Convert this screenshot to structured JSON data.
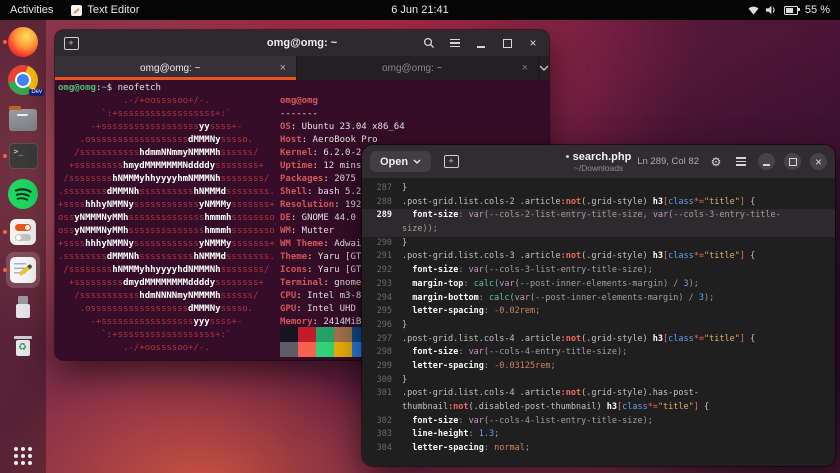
{
  "topbar": {
    "activities": "Activities",
    "app_name": "Text Editor",
    "clock": "6 Jun 21:41",
    "battery": "55 %"
  },
  "accent_color": "#e95420",
  "dock": {
    "chrome_badge": "Dev",
    "items": [
      {
        "name": "firefox",
        "running": true
      },
      {
        "name": "chrome-dev",
        "running": false
      },
      {
        "name": "files",
        "running": false
      },
      {
        "name": "terminal",
        "running": true
      },
      {
        "name": "spotify",
        "running": false
      },
      {
        "name": "toggles-settings",
        "running": true
      },
      {
        "name": "text-editor",
        "running": true,
        "active": true
      },
      {
        "name": "usb-drive",
        "running": false
      },
      {
        "name": "trash",
        "running": false
      }
    ]
  },
  "terminal": {
    "title": "omg@omg: ~",
    "tabs": [
      {
        "label": "omg@omg: ~",
        "active": true
      },
      {
        "label": "omg@omg: ~",
        "active": false
      }
    ],
    "prompt": {
      "user": "omg@omg",
      "colon": ":",
      "path": "~",
      "cmd": "$ neofetch"
    },
    "ascii_art": [
      "            .-/+oossssoo+/-.",
      "        `:+ssssssssssssssssss+:`",
      "      -+ssssssssssssssssssyyssss+-",
      "    .ossssssssssssssssssdMMMNysssso.",
      "   /ssssssssssshdmmNNmmyNMMMMhssssss/",
      "  +ssssssssshmydMMMMMMMNddddyssssssss+",
      " /sssssssshNMMMyhhyyyyhmNMMMNhssssssss/",
      ".ssssssssdMMMNhsssssssssshNMMMdssssssss.",
      "+sssshhhyNMMNyssssssssssssyNMMMysssssss+",
      "ossyNMMMNyMMhsssssssssssssshmmmhssssssso",
      "ossyNMMMNyMMhsssssssssssssshmmmhssssssso",
      "+sssshhhyNMMNyssssssssssssyNMMMysssssss+",
      ".ssssssssdMMMNhsssssssssshNMMMdssssssss.",
      " /sssssssshNMMMyhhyyyyhdNMMMNhssssssss/",
      "  +sssssssssdmydMMMMMMMMddddyssssssss+",
      "   /ssssssssssshdmNNNNmyNMMMMhssssss/",
      "    .ossssssssssssssssssdMMMNysssso.",
      "      -+sssssssssssssssssyyyssss+-",
      "        `:+ssssssssssssssssss+:`",
      "            .-/+oossssoo+/-."
    ],
    "info": {
      "title": "omg@omg",
      "underline": "-------",
      "rows": [
        [
          "OS",
          "Ubuntu 23.04 x86_64"
        ],
        [
          "Host",
          "AeroBook Pro"
        ],
        [
          "Kernel",
          "6.2.0-2"
        ],
        [
          "Uptime",
          "12 mins"
        ],
        [
          "Packages",
          "2075"
        ],
        [
          "Shell",
          "bash 5.2"
        ],
        [
          "Resolution",
          "192"
        ],
        [
          "DE",
          "GNOME 44.0"
        ],
        [
          "WM",
          "Mutter"
        ],
        [
          "WM Theme",
          "Adwai"
        ],
        [
          "Theme",
          "Yaru [GT"
        ],
        [
          "Icons",
          "Yaru [GT"
        ],
        [
          "Terminal",
          "gnome"
        ],
        [
          "CPU",
          "Intel m3-8"
        ],
        [
          "GPU",
          "Intel UHD"
        ],
        [
          "Memory",
          "2414MiB"
        ]
      ]
    },
    "palette": {
      "row1": [
        "#171421",
        "#c01c28",
        "#26a269",
        "#a2734c",
        "#12488b",
        "#a347ba",
        "#2aa1b3",
        "#d0cfcc"
      ],
      "row2": [
        "#5e5c64",
        "#f66151",
        "#33d17a",
        "#e9ad0c",
        "#2a7bde",
        "#c061cb",
        "#33c7de",
        "#ffffff"
      ]
    }
  },
  "editor": {
    "open_label": "Open",
    "title": "search.php",
    "subtitle": "~/Downloads",
    "position": "Ln 289, Col 82",
    "current_line": "289",
    "code": {
      "rows": [
        {
          "n": "287",
          "s": [
            [
              "sel",
              "}"
            ]
          ]
        },
        {
          "n": "288",
          "s": [
            [
              "sel",
              ".post-grid.list.cols-2 .article"
            ],
            [
              "not",
              ":not"
            ],
            [
              "sel",
              "(.grid-style) "
            ],
            [
              "el",
              "h3"
            ],
            [
              "br",
              "["
            ],
            [
              "attr",
              "class"
            ],
            [
              "op",
              "*="
            ],
            [
              "str",
              "\"title\""
            ],
            [
              "br",
              "]"
            ],
            [
              "sel",
              " {"
            ]
          ]
        },
        {
          "n": "289",
          "hl": true,
          "s": [
            [
              "punc",
              "  "
            ],
            [
              "prop",
              "font-size"
            ],
            [
              "punc",
              ": "
            ],
            [
              "var",
              "var("
            ],
            [
              "vn",
              "--cols-2-list-entry-title-size"
            ],
            [
              "punc",
              ", "
            ],
            [
              "var",
              "var("
            ],
            [
              "vn",
              "--cols-3-entry-title-"
            ]
          ]
        },
        {
          "n": "",
          "hl": true,
          "s": [
            [
              "vn",
              "size"
            ],
            [
              "punc",
              "));"
            ]
          ]
        },
        {
          "n": "290",
          "s": [
            [
              "sel",
              "}"
            ]
          ]
        },
        {
          "n": "291",
          "s": [
            [
              "sel",
              ".post-grid.list.cols-3 .article"
            ],
            [
              "not",
              ":not"
            ],
            [
              "sel",
              "(.grid-style) "
            ],
            [
              "el",
              "h3"
            ],
            [
              "br",
              "["
            ],
            [
              "attr",
              "class"
            ],
            [
              "op",
              "*="
            ],
            [
              "str",
              "\"title\""
            ],
            [
              "br",
              "]"
            ],
            [
              "sel",
              " {"
            ]
          ]
        },
        {
          "n": "292",
          "s": [
            [
              "punc",
              "  "
            ],
            [
              "prop",
              "font-size"
            ],
            [
              "punc",
              ": "
            ],
            [
              "var",
              "var("
            ],
            [
              "vn",
              "--cols-3-list-entry-title-size"
            ],
            [
              "punc",
              ");"
            ]
          ]
        },
        {
          "n": "293",
          "s": [
            [
              "punc",
              "  "
            ],
            [
              "prop",
              "margin-top"
            ],
            [
              "punc",
              ": "
            ],
            [
              "fn",
              "calc("
            ],
            [
              "var",
              "var("
            ],
            [
              "vn",
              "--post-inner-elements-margin"
            ],
            [
              "punc",
              ") / "
            ],
            [
              "num",
              "3"
            ],
            [
              "punc",
              ");"
            ]
          ]
        },
        {
          "n": "294",
          "s": [
            [
              "punc",
              "  "
            ],
            [
              "prop",
              "margin-bottom"
            ],
            [
              "punc",
              ": "
            ],
            [
              "fn",
              "calc("
            ],
            [
              "var",
              "var("
            ],
            [
              "vn",
              "--post-inner-elements-margin"
            ],
            [
              "punc",
              ") / "
            ],
            [
              "num",
              "3"
            ],
            [
              "punc",
              ");"
            ]
          ]
        },
        {
          "n": "295",
          "s": [
            [
              "punc",
              "  "
            ],
            [
              "prop",
              "letter-spacing"
            ],
            [
              "punc",
              ": "
            ],
            [
              "unit",
              "-0.02rem"
            ],
            [
              "punc",
              ";"
            ]
          ]
        },
        {
          "n": "296",
          "s": [
            [
              "sel",
              "}"
            ]
          ]
        },
        {
          "n": "297",
          "s": [
            [
              "sel",
              ".post-grid.list.cols-4 .article"
            ],
            [
              "not",
              ":not"
            ],
            [
              "sel",
              "(.grid-style) "
            ],
            [
              "el",
              "h3"
            ],
            [
              "br",
              "["
            ],
            [
              "attr",
              "class"
            ],
            [
              "op",
              "*="
            ],
            [
              "str",
              "\"title\""
            ],
            [
              "br",
              "]"
            ],
            [
              "sel",
              " {"
            ]
          ]
        },
        {
          "n": "298",
          "s": [
            [
              "punc",
              "  "
            ],
            [
              "prop",
              "font-size"
            ],
            [
              "punc",
              ": "
            ],
            [
              "var",
              "var("
            ],
            [
              "vn",
              "--cols-4-entry-title-size"
            ],
            [
              "punc",
              ");"
            ]
          ]
        },
        {
          "n": "299",
          "s": [
            [
              "punc",
              "  "
            ],
            [
              "prop",
              "letter-spacing"
            ],
            [
              "punc",
              ": "
            ],
            [
              "unit",
              "-0.03125rem"
            ],
            [
              "punc",
              ";"
            ]
          ]
        },
        {
          "n": "300",
          "s": [
            [
              "sel",
              "}"
            ]
          ]
        },
        {
          "n": "301",
          "s": [
            [
              "sel",
              ".post-grid.list.cols-4 .article"
            ],
            [
              "not",
              ":not"
            ],
            [
              "sel",
              "(.grid-style).has-post-"
            ]
          ]
        },
        {
          "n": "",
          "s": [
            [
              "sel",
              "thumbnail"
            ],
            [
              "not",
              ":not"
            ],
            [
              "sel",
              "(.disabled-post-thumbnail) "
            ],
            [
              "el",
              "h3"
            ],
            [
              "br",
              "["
            ],
            [
              "attr",
              "class"
            ],
            [
              "op",
              "*="
            ],
            [
              "str",
              "\"title\""
            ],
            [
              "br",
              "]"
            ],
            [
              "sel",
              " {"
            ]
          ]
        },
        {
          "n": "302",
          "s": [
            [
              "punc",
              "  "
            ],
            [
              "prop",
              "font-size"
            ],
            [
              "punc",
              ": "
            ],
            [
              "var",
              "var("
            ],
            [
              "vn",
              "--cols-4-list-entry-title-size"
            ],
            [
              "punc",
              ");"
            ]
          ]
        },
        {
          "n": "303",
          "s": [
            [
              "punc",
              "  "
            ],
            [
              "prop",
              "line-height"
            ],
            [
              "punc",
              ": "
            ],
            [
              "num",
              "1.3"
            ],
            [
              "punc",
              ";"
            ]
          ]
        },
        {
          "n": "304",
          "s": [
            [
              "punc",
              "  "
            ],
            [
              "prop",
              "letter-spacing"
            ],
            [
              "punc",
              ": "
            ],
            [
              "kw",
              "normal"
            ],
            [
              "punc",
              ";"
            ]
          ]
        }
      ]
    }
  }
}
